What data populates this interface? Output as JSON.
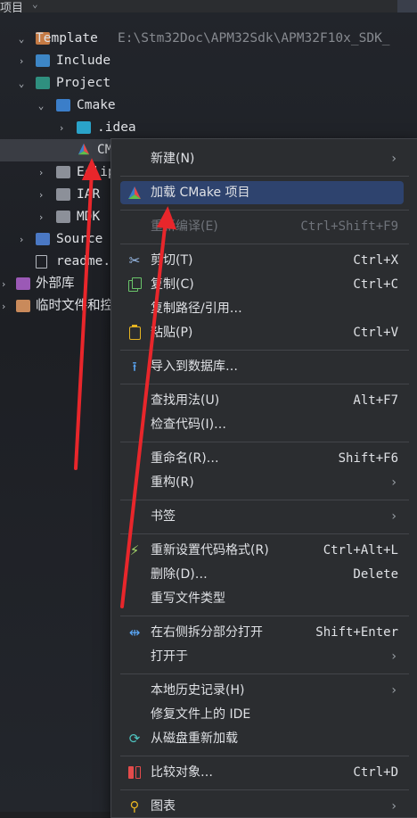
{
  "panel": {
    "title": "项目",
    "chevron": "⌄"
  },
  "tree": [
    {
      "label": "Template",
      "path": "E:\\Stm32Doc\\APM32Sdk\\APM32F10x_SDK_",
      "arrow": "⌄",
      "icon": "module-folder-icon"
    },
    {
      "label": "Include",
      "arrow": "›",
      "icon": "include-folder-icon"
    },
    {
      "label": "Project",
      "arrow": "⌄",
      "icon": "source-folder-icon"
    },
    {
      "label": "Cmake",
      "arrow": "⌄",
      "icon": "cmake-folder-icon"
    },
    {
      "label": ".idea",
      "arrow": "›",
      "icon": "idea-folder-icon"
    },
    {
      "label": "CM",
      "arrow": "",
      "icon": "cmake-file-icon"
    },
    {
      "label": "Eclip",
      "arrow": "›",
      "icon": "folder-icon"
    },
    {
      "label": "IAR",
      "arrow": "›",
      "icon": "folder-icon"
    },
    {
      "label": "MDK",
      "arrow": "›",
      "icon": "folder-icon"
    },
    {
      "label": "Source",
      "arrow": "›",
      "icon": "source-folder-icon"
    },
    {
      "label": "readme.",
      "arrow": "",
      "icon": "text-file-icon"
    },
    {
      "label": "外部库",
      "arrow": "›",
      "icon": "library-icon"
    },
    {
      "label": "临时文件和控",
      "arrow": "›",
      "icon": "scratch-icon"
    }
  ],
  "menu": {
    "new": {
      "label": "新建(N)",
      "submenu": "›"
    },
    "load_cmake": {
      "label": "加载 CMake 项目"
    },
    "recompile": {
      "label": "重新编译(E)",
      "shortcut": "Ctrl+Shift+F9"
    },
    "cut": {
      "label": "剪切(T)",
      "shortcut": "Ctrl+X"
    },
    "copy": {
      "label": "复制(C)",
      "shortcut": "Ctrl+C"
    },
    "copy_path": {
      "label": "复制路径/引用…"
    },
    "paste": {
      "label": "粘贴(P)",
      "shortcut": "Ctrl+V"
    },
    "import_db": {
      "label": "导入到数据库…"
    },
    "find_usages": {
      "label": "查找用法(U)",
      "shortcut": "Alt+F7"
    },
    "inspect": {
      "label": "检查代码(I)…"
    },
    "rename": {
      "label": "重命名(R)…",
      "shortcut": "Shift+F6"
    },
    "refactor": {
      "label": "重构(R)",
      "submenu": "›"
    },
    "bookmarks": {
      "label": "书签",
      "submenu": "›"
    },
    "reformat": {
      "label": "重新设置代码格式(R)",
      "shortcut": "Ctrl+Alt+L"
    },
    "delete": {
      "label": "删除(D)…",
      "shortcut": "Delete"
    },
    "override_type": {
      "label": "重写文件类型"
    },
    "open_right": {
      "label": "在右侧拆分部分打开",
      "shortcut": "Shift+Enter"
    },
    "open_in": {
      "label": "打开于",
      "submenu": "›"
    },
    "local_history": {
      "label": "本地历史记录(H)",
      "submenu": "›"
    },
    "repair_ide": {
      "label": "修复文件上的 IDE"
    },
    "reload_disk": {
      "label": "从磁盘重新加载"
    },
    "compare": {
      "label": "比较对象…",
      "shortcut": "Ctrl+D"
    },
    "diagrams": {
      "label": "图表",
      "submenu": "›"
    }
  },
  "colors": {
    "accent": "#2e436e",
    "annotation": "#e8262b"
  }
}
